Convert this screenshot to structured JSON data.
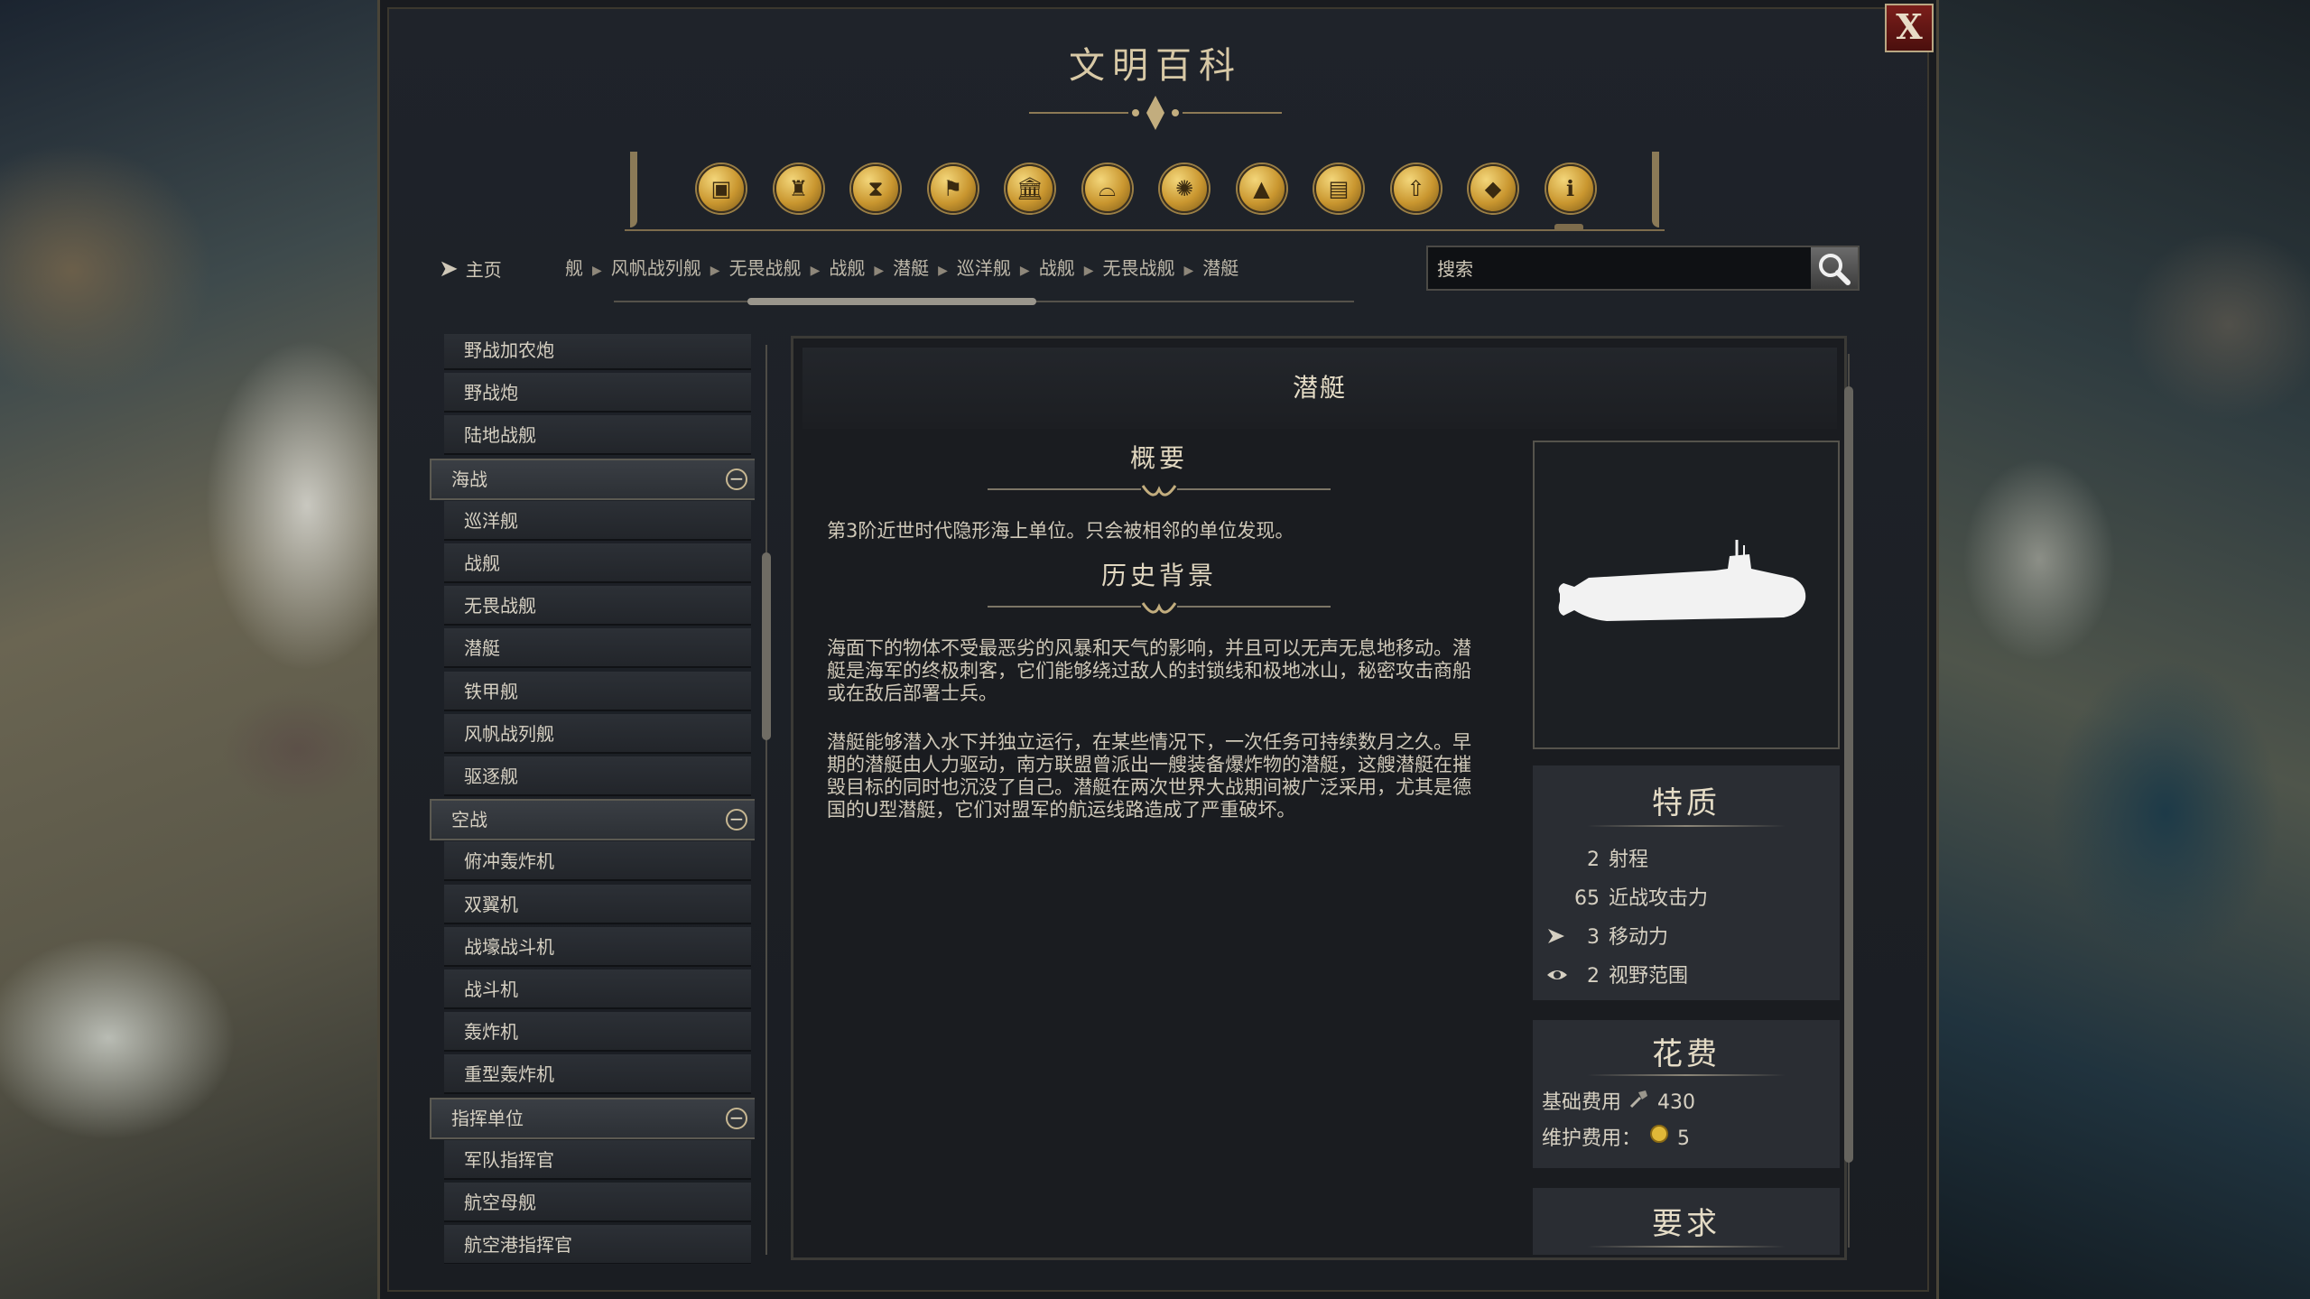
{
  "window": {
    "title": "文明百科",
    "close_label": "X"
  },
  "category_icons": [
    {
      "name": "units-icon",
      "glyph": "▣"
    },
    {
      "name": "wonders-icon",
      "glyph": "♜"
    },
    {
      "name": "eras-icon",
      "glyph": "⧗"
    },
    {
      "name": "civilizations-icon",
      "glyph": "⚑"
    },
    {
      "name": "buildings-icon",
      "glyph": "🏛"
    },
    {
      "name": "improvements-icon",
      "glyph": "⌓"
    },
    {
      "name": "technologies-icon",
      "glyph": "✺"
    },
    {
      "name": "terrain-icon",
      "glyph": "▲"
    },
    {
      "name": "districts-icon",
      "glyph": "▤"
    },
    {
      "name": "upgrades-icon",
      "glyph": "⇧"
    },
    {
      "name": "resources-icon",
      "glyph": "◆"
    },
    {
      "name": "info-icon",
      "glyph": "ℹ"
    }
  ],
  "nav": {
    "home_label": "主页",
    "breadcrumbs": [
      "舰",
      "风帆战列舰",
      "无畏战舰",
      "战舰",
      "潜艇",
      "巡洋舰",
      "战舰",
      "无畏战舰",
      "潜艇"
    ],
    "search_placeholder": "搜索"
  },
  "list": {
    "entries": [
      {
        "type": "item",
        "label": "野战加农炮"
      },
      {
        "type": "item",
        "label": "野战炮"
      },
      {
        "type": "item",
        "label": "陆地战舰"
      },
      {
        "type": "group",
        "label": "海战"
      },
      {
        "type": "item",
        "label": "巡洋舰"
      },
      {
        "type": "item",
        "label": "战舰"
      },
      {
        "type": "item",
        "label": "无畏战舰"
      },
      {
        "type": "item",
        "label": "潜艇"
      },
      {
        "type": "item",
        "label": "铁甲舰"
      },
      {
        "type": "item",
        "label": "风帆战列舰"
      },
      {
        "type": "item",
        "label": "驱逐舰"
      },
      {
        "type": "group",
        "label": "空战"
      },
      {
        "type": "item",
        "label": "俯冲轰炸机"
      },
      {
        "type": "item",
        "label": "双翼机"
      },
      {
        "type": "item",
        "label": "战壕战斗机"
      },
      {
        "type": "item",
        "label": "战斗机"
      },
      {
        "type": "item",
        "label": "轰炸机"
      },
      {
        "type": "item",
        "label": "重型轰炸机"
      },
      {
        "type": "group",
        "label": "指挥单位"
      },
      {
        "type": "item",
        "label": "军队指挥官"
      },
      {
        "type": "item",
        "label": "航空母舰"
      },
      {
        "type": "item",
        "label": "航空港指挥官"
      }
    ]
  },
  "detail": {
    "heading": "潜艇",
    "summary_title": "概要",
    "summary_text": "第3阶近世时代隐形海上单位。只会被相邻的单位发现。",
    "history_title": "历史背景",
    "history_p1": "海面下的物体不受最恶劣的风暴和天气的影响，并且可以无声无息地移动。潜艇是海军的终极刺客，它们能够绕过敌人的封锁线和极地冰山，秘密攻击商船或在敌后部署士兵。",
    "history_p2": "潜艇能够潜入水下并独立运行，在某些情况下，一次任务可持续数月之久。早期的潜艇由人力驱动，南方联盟曾派出一艘装备爆炸物的潜艇，这艘潜艇在摧毁目标的同时也沉没了自己。潜艇在两次世界大战期间被广泛采用，尤其是德国的U型潜艇，它们对盟军的航运线路造成了严重破坏。"
  },
  "traits": {
    "title": "特质",
    "items": [
      {
        "value": "2",
        "label": "射程",
        "icon": ""
      },
      {
        "value": "65",
        "label": "近战攻击力",
        "icon": ""
      },
      {
        "value": "3",
        "label": "移动力",
        "icon": "movement-icon"
      },
      {
        "value": "2",
        "label": "视野范围",
        "icon": "sight-icon"
      }
    ]
  },
  "cost": {
    "title": "花费",
    "base_label": "基础费用",
    "base_value": "430",
    "upkeep_label": "维护费用：",
    "upkeep_value": "5"
  },
  "requirements": {
    "title": "要求"
  },
  "colors": {
    "accent_gold": "#c9962f",
    "text": "#d6d0c2",
    "close_red": "#7b1e1b"
  }
}
